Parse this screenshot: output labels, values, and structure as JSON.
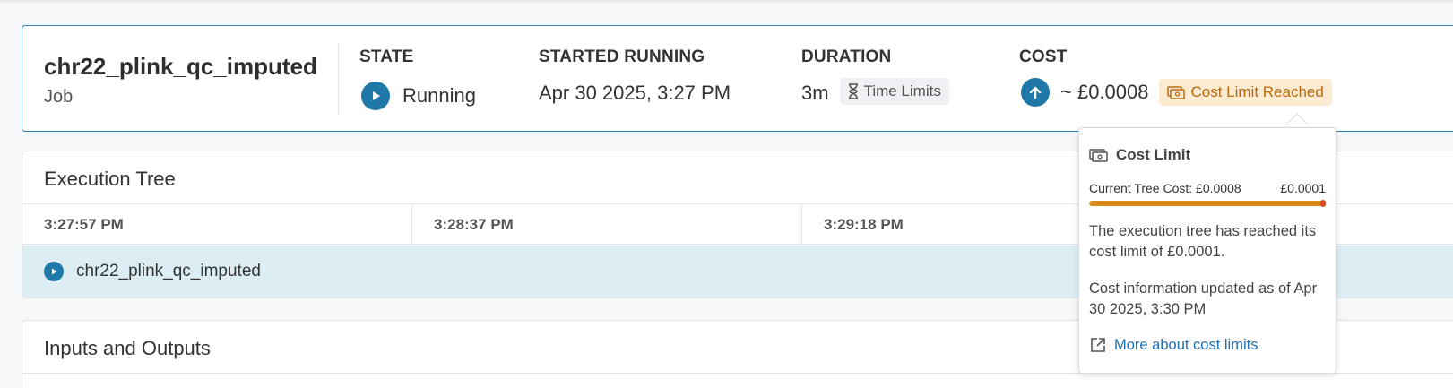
{
  "job": {
    "name": "chr22_plink_qc_imputed",
    "type": "Job",
    "state": {
      "label": "STATE",
      "value": "Running",
      "icon": "play-circle-icon"
    },
    "started": {
      "label": "STARTED RUNNING",
      "value": "Apr 30 2025, 3:27 PM"
    },
    "duration": {
      "label": "DURATION",
      "value": "3m",
      "chip": "Time Limits",
      "chip_icon": "hourglass-icon"
    },
    "cost": {
      "label": "COST",
      "value": "~ £0.0008",
      "icon": "arrow-up-circle-icon",
      "chip": "Cost Limit Reached",
      "chip_icon": "money-icon"
    }
  },
  "execution_tree": {
    "title": "Execution Tree",
    "ticks": [
      "3:27:57 PM",
      "3:28:37 PM",
      "3:29:18 PM"
    ],
    "row": {
      "label": "chr22_plink_qc_imputed",
      "icon": "play-circle-icon"
    }
  },
  "inputs_outputs": {
    "title": "Inputs and Outputs"
  },
  "popover": {
    "title": "Cost Limit",
    "current_label": "Current Tree Cost: £0.0008",
    "limit_label": "£0.0001",
    "progress": 1.0,
    "message": "The execution tree has reached its cost limit of £0.0001.",
    "updated": "Cost information updated as of Apr 30 2025, 3:30 PM",
    "link": "More about cost limits",
    "link_icon": "external-link-icon"
  },
  "colors": {
    "accent": "#1f78a8",
    "warning_bg": "#fcebd1",
    "warning_text": "#b96a10",
    "bar": "#d98a1a",
    "bar_end": "#d9472b",
    "tree_row": "#dcedf3"
  }
}
